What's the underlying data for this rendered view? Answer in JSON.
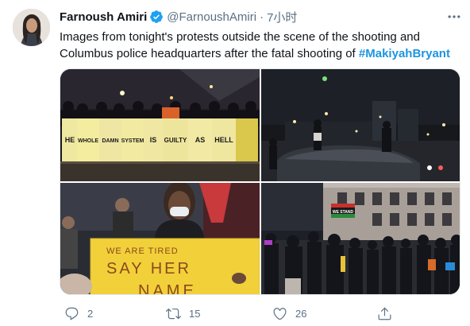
{
  "author": {
    "display_name": "Farnoush Amiri",
    "handle": "@FarnoushAmiri",
    "separator": "·",
    "time": "7小时"
  },
  "tweet": {
    "text_before": "Images from tonight's protests outside the scene of the shooting and Columbus police headquarters after the fatal shooting of ",
    "hashtag": "#MakiyahBryant"
  },
  "media": {
    "photo1": {
      "sign_words": [
        "HE",
        "WHOLE",
        "DAMN",
        "SYSTEM",
        "IS",
        "GUILTY",
        "AS",
        "HELL"
      ]
    },
    "photo3": {
      "sign_line1": "WE ARE TIRED",
      "sign_line2": "SAY HER",
      "sign_line3": "NAME"
    },
    "photo4": {
      "banner_text": "WE STAND"
    }
  },
  "actions": {
    "reply_count": "2",
    "retweet_count": "15",
    "like_count": "26",
    "share_count": ""
  },
  "colors": {
    "verified": "#1da1f2",
    "hashtag": "#1b95e0",
    "secondary_text": "#5b7083"
  },
  "icons": {
    "verified": "verified-badge-icon",
    "more": "more-icon",
    "reply": "reply-icon",
    "retweet": "retweet-icon",
    "like": "like-icon",
    "share": "share-icon"
  }
}
